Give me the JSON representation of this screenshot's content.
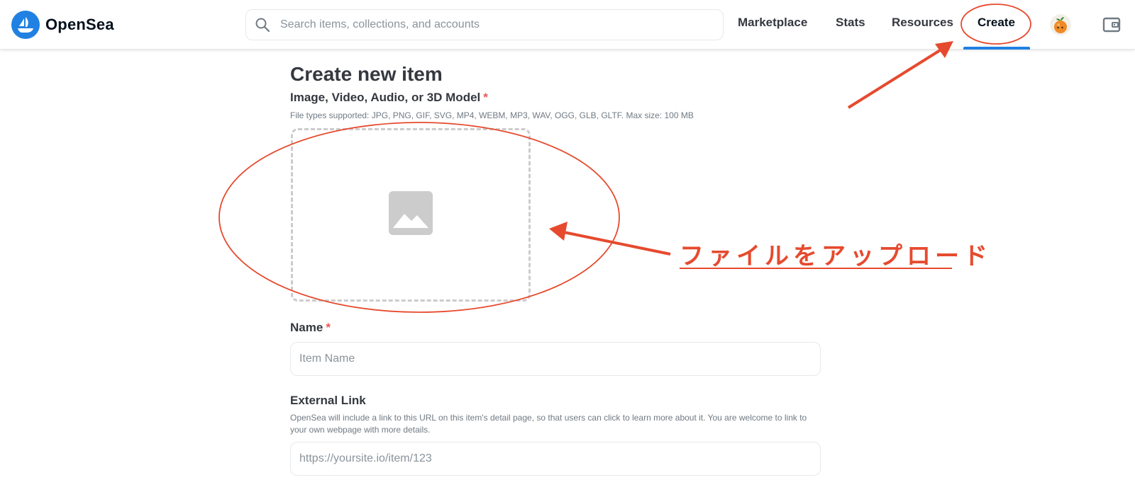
{
  "header": {
    "brand": "OpenSea",
    "search_placeholder": "Search items, collections, and accounts",
    "nav": {
      "marketplace": "Marketplace",
      "stats": "Stats",
      "resources": "Resources",
      "create": "Create"
    }
  },
  "form": {
    "title": "Create new item",
    "media": {
      "label": "Image, Video, Audio, or 3D Model",
      "required_mark": "*",
      "help": "File types supported: JPG, PNG, GIF, SVG, MP4, WEBM, MP3, WAV, OGG, GLB, GLTF. Max size: 100 MB"
    },
    "name": {
      "label": "Name",
      "required_mark": "*",
      "placeholder": "Item Name",
      "value": ""
    },
    "external_link": {
      "label": "External Link",
      "help": "OpenSea will include a link to this URL on this item's detail page, so that users can click to learn more about it. You are welcome to link to your own webpage with more details.",
      "placeholder": "https://yoursite.io/item/123",
      "value": ""
    }
  },
  "annotation": {
    "callout_text": "ファイルをアップロード",
    "color": "#e64a2e"
  },
  "colors": {
    "brand_blue": "#2081e2",
    "required_red": "#eb5757"
  },
  "icons": {
    "logo": "opensea-boat-icon",
    "search": "search-icon",
    "avatar": "orange-fruit-avatar",
    "wallet": "wallet-icon",
    "dropzone": "image-placeholder-icon"
  }
}
